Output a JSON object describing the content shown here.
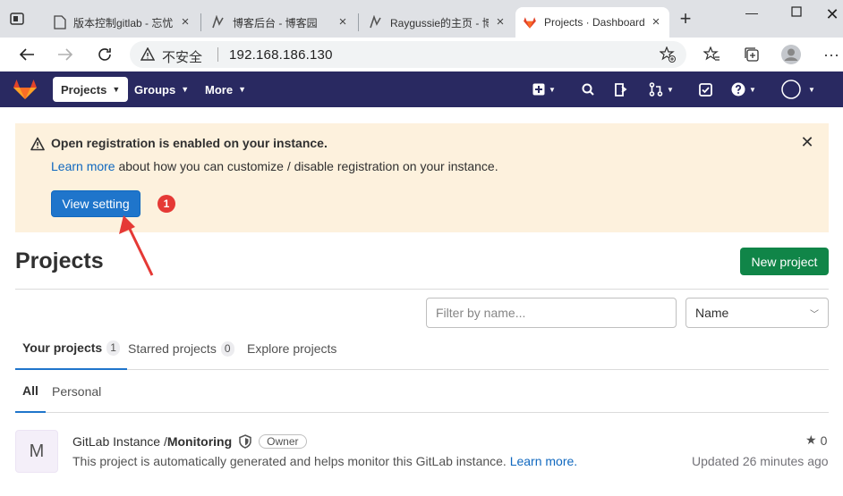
{
  "browser": {
    "tabs": [
      {
        "title": "版本控制gitlab - 忘忧"
      },
      {
        "title": "博客后台 - 博客园"
      },
      {
        "title": "Raygussie的主页 - 博"
      },
      {
        "title": "Projects · Dashboard"
      }
    ],
    "new_tab_label": "+",
    "insecure_label": "不安全",
    "url": "192.168.186.130"
  },
  "navbar": {
    "projects_label": "Projects",
    "groups_label": "Groups",
    "more_label": "More"
  },
  "alert": {
    "title": "Open registration is enabled on your instance.",
    "link_text": "Learn more",
    "body_text": " about how you can customize / disable registration on your instance.",
    "button_label": "View setting",
    "step_number": "1"
  },
  "page": {
    "title": "Projects",
    "new_project_label": "New project",
    "filter_placeholder": "Filter by name...",
    "sort_value": "Name"
  },
  "tabs": [
    {
      "label": "Your projects",
      "count": "1"
    },
    {
      "label": "Starred projects",
      "count": "0"
    },
    {
      "label": "Explore projects"
    }
  ],
  "subtabs": [
    {
      "label": "All"
    },
    {
      "label": "Personal"
    }
  ],
  "project": {
    "avatar_letter": "M",
    "namespace": "GitLab Instance / ",
    "name": "Monitoring",
    "role": "Owner",
    "description": "This project is automatically generated and helps monitor this GitLab instance. ",
    "learn_more": "Learn more.",
    "stars": "0",
    "updated": "Updated 26 minutes ago"
  },
  "colors": {
    "navbar": "#292961",
    "primary": "#1f75cb",
    "success": "#108548",
    "alert_bg": "#fdf1dd",
    "annotation": "#e53935"
  }
}
